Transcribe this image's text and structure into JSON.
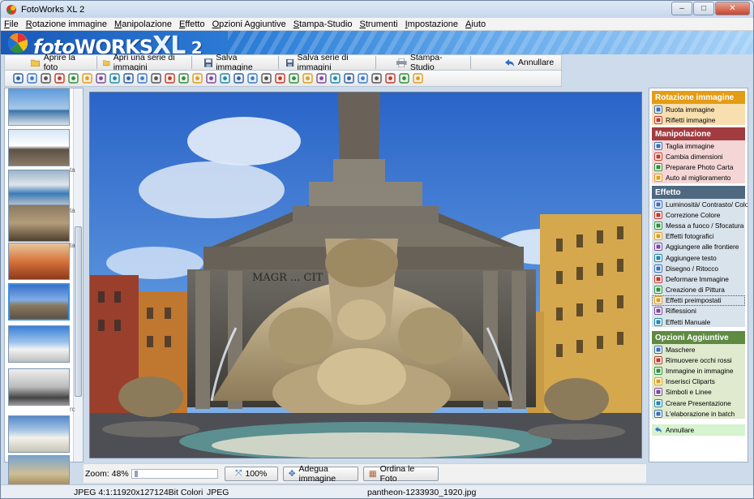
{
  "window": {
    "title": "FotoWorks XL 2",
    "minimize": "–",
    "maximize": "□",
    "close": "✕"
  },
  "menu": [
    "File",
    "Rotazione immagine",
    "Manipolazione",
    "Effetto",
    "Opzioni Aggiuntive",
    "Stampa-Studio",
    "Strumenti",
    "Impostazione",
    "Aiuto"
  ],
  "banner": {
    "brand_italic": "foto",
    "brand_bold": "WORKS",
    "brand_xl": "XL",
    "brand_version": "2"
  },
  "toolbar": {
    "open_photo": "Aprire la foto",
    "open_series": "Apri una serie di immagini",
    "save_image": "Salva immagine",
    "save_series": "Salva serie di immagini",
    "print_studio": "Stampa-Studio",
    "undo": "Annullare"
  },
  "tool_icons": [
    "rotate-left",
    "rotate-right",
    "rotate-ccw",
    "rotate-cw",
    "flip",
    "mirror",
    "effect",
    "cut",
    "crop",
    "transform",
    "brush",
    "color-levels",
    "rgb",
    "frame",
    "photo-frame",
    "image",
    "text-a",
    "draw-pencil",
    "photo-card",
    "fill",
    "fx-a",
    "fx-b",
    "picture",
    "mask",
    "red-eye",
    "picture-in-picture",
    "clipart",
    "shape",
    "star",
    "batch"
  ],
  "thumbnails": {
    "labels": [
      "",
      "ta",
      "ta",
      "ta",
      "",
      "",
      "",
      "rc",
      "",
      "vi"
    ]
  },
  "zoom": {
    "label": "Zoom: 48%",
    "btn_100": "100%",
    "btn_fit": "Adegua immagine",
    "btn_sort": "Ordina le Foto"
  },
  "status": {
    "format": "JPEG 4:1:1",
    "dimensions": "1920x1271",
    "colors": "24Bit Colori",
    "type": "JPEG",
    "filename": "pantheon-1233930_1920.jpg"
  },
  "panel": {
    "rotation": {
      "title": "Rotazione immagine",
      "items": [
        "Ruota immagine",
        "Rifletti immagine"
      ]
    },
    "manipulation": {
      "title": "Manipolazione",
      "items": [
        "Taglia immagine",
        "Cambia dimensioni",
        "Preparare Photo Carta",
        "Auto al miglioramento"
      ]
    },
    "effect": {
      "title": "Effetto",
      "items": [
        "Luminosità/ Contrasto/ Colore",
        "Correzione Colore",
        "Messa a fuoco / Sfocatura",
        "Effetti fotografici",
        "Aggiungere alle frontiere",
        "Aggiungere testo",
        "Disegno / Ritocco",
        "Deformare Immagine",
        "Creazione di Pittura",
        "Effetti preimpostati",
        "Riflessioni",
        "Effetti Manuale"
      ]
    },
    "options": {
      "title": "Opzioni Aggiuntive",
      "items": [
        "Maschere",
        "Rimuovere occhi rossi",
        "Immagine in immagine",
        "Inserisci Cliparts",
        "Simboli e Linee",
        "Creare Presentazione",
        "L'elaborazione in batch"
      ]
    },
    "undo": "Annullare"
  },
  "colors": {
    "rotation_header": "#e39c16",
    "rotation_body": "#f8dfb0",
    "manipulation_header": "#a23c40",
    "manipulation_body": "#f4d6d6",
    "effect_header": "#4e6880",
    "effect_body": "#d9e3ec",
    "options_header": "#5f8a42",
    "options_body": "#dfeace",
    "undo_body": "#d5f3cf"
  },
  "image": {
    "inscription": "MAGR ... CIT"
  }
}
